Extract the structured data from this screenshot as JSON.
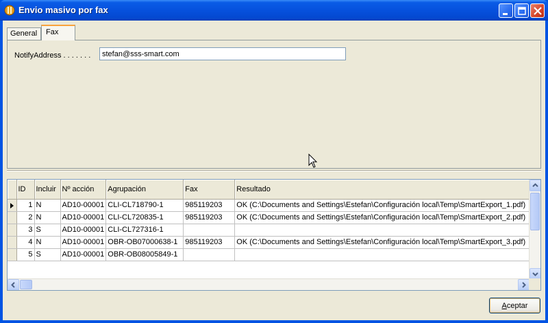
{
  "window": {
    "title": "Envio masivo por fax"
  },
  "tabs": [
    {
      "label": "General",
      "active": false
    },
    {
      "label": "Fax",
      "active": true
    }
  ],
  "fax_tab": {
    "notify_label": "NotifyAddress . . . . . . .",
    "notify_value": "stefan@sss-smart.com"
  },
  "grid": {
    "columns": [
      "ID",
      "Incluir",
      "Nº acción",
      "Agrupación",
      "Fax",
      "Resultado"
    ],
    "rows": [
      {
        "id": "1",
        "incluir": "N",
        "accion": "AD10-00001",
        "agrupacion": "CLI-CL718790-1",
        "fax": "985119203",
        "resultado": "OK (C:\\Documents and Settings\\Estefan\\Configuración local\\Temp\\SmartExport_1.pdf)",
        "current": true
      },
      {
        "id": "2",
        "incluir": "N",
        "accion": "AD10-00001",
        "agrupacion": "CLI-CL720835-1",
        "fax": "985119203",
        "resultado": "OK (C:\\Documents and Settings\\Estefan\\Configuración local\\Temp\\SmartExport_2.pdf)",
        "current": false
      },
      {
        "id": "3",
        "incluir": "S",
        "accion": "AD10-00001",
        "agrupacion": "CLI-CL727316-1",
        "fax": "",
        "resultado": "",
        "current": false
      },
      {
        "id": "4",
        "incluir": "N",
        "accion": "AD10-00001",
        "agrupacion": "OBR-OB07000638-1",
        "fax": "985119203",
        "resultado": "OK (C:\\Documents and Settings\\Estefan\\Configuración local\\Temp\\SmartExport_3.pdf)",
        "current": false
      },
      {
        "id": "5",
        "incluir": "S",
        "accion": "AD10-00001",
        "agrupacion": "OBR-OB08005849-1",
        "fax": "",
        "resultado": "",
        "current": false
      }
    ]
  },
  "buttons": {
    "accept_prefix": "A",
    "accept_rest": "ceptar"
  },
  "colors": {
    "title_bar": "#0651dd",
    "window_bg": "#ece9d8",
    "active_tab_accent": "#f9a23b"
  },
  "icons": [
    "app-icon",
    "minimize-icon",
    "maximize-icon",
    "close-icon",
    "row-indicator-icon",
    "mouse-pointer-icon"
  ]
}
